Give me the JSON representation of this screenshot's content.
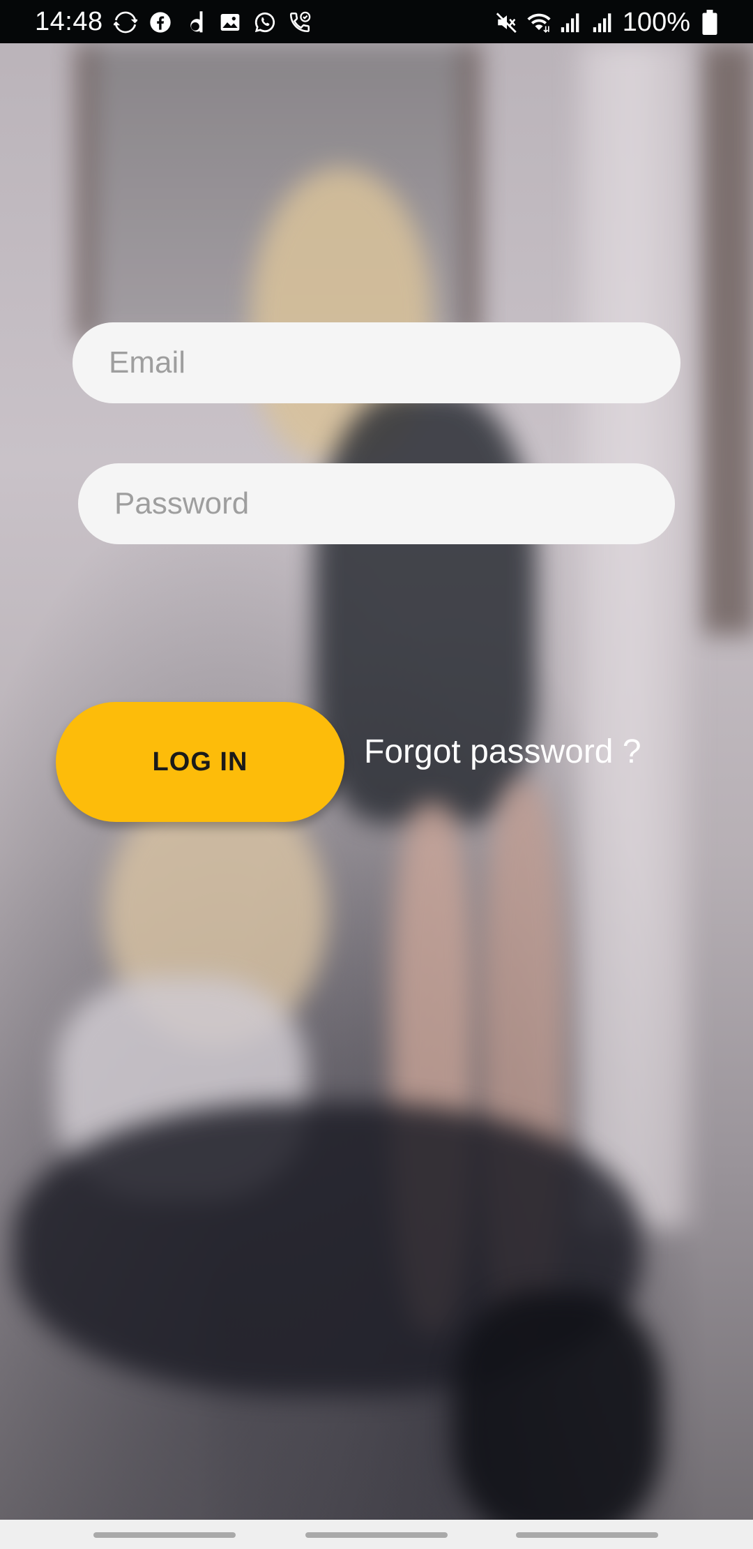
{
  "status_bar": {
    "time": "14:48",
    "left_icons": [
      "sync-icon",
      "facebook-icon",
      "d-app-icon",
      "gallery-icon",
      "whatsapp-icon",
      "call-icon"
    ],
    "right_icons": [
      "mute-icon",
      "wifi-icon",
      "signal-icon",
      "signal-icon"
    ],
    "battery_percent": "100%"
  },
  "login_form": {
    "email_placeholder": "Email",
    "email_value": "",
    "password_placeholder": "Password",
    "password_value": "",
    "login_button_label": "LOG IN",
    "forgot_password_label": "Forgot password ?"
  },
  "colors": {
    "accent": "#fdbc0a",
    "input_background": "#f5f5f5",
    "status_bar": "#050708"
  }
}
